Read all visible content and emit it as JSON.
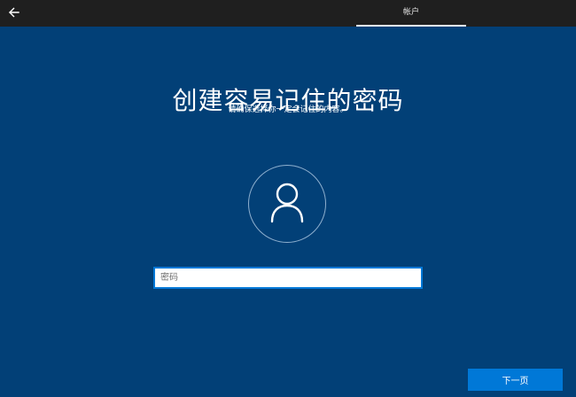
{
  "topbar": {
    "back_icon": "back-arrow-icon",
    "tab_label": "帐户"
  },
  "main": {
    "title": "创建容易记住的密码",
    "subtitle": "请确保选择你一定会记住的内容。",
    "avatar_icon": "user-avatar-icon"
  },
  "password": {
    "placeholder": "密码",
    "value": ""
  },
  "footer": {
    "next_label": "下一页"
  },
  "colors": {
    "background": "#024077",
    "topbar": "#1f1f1f",
    "accent": "#0078d7"
  }
}
